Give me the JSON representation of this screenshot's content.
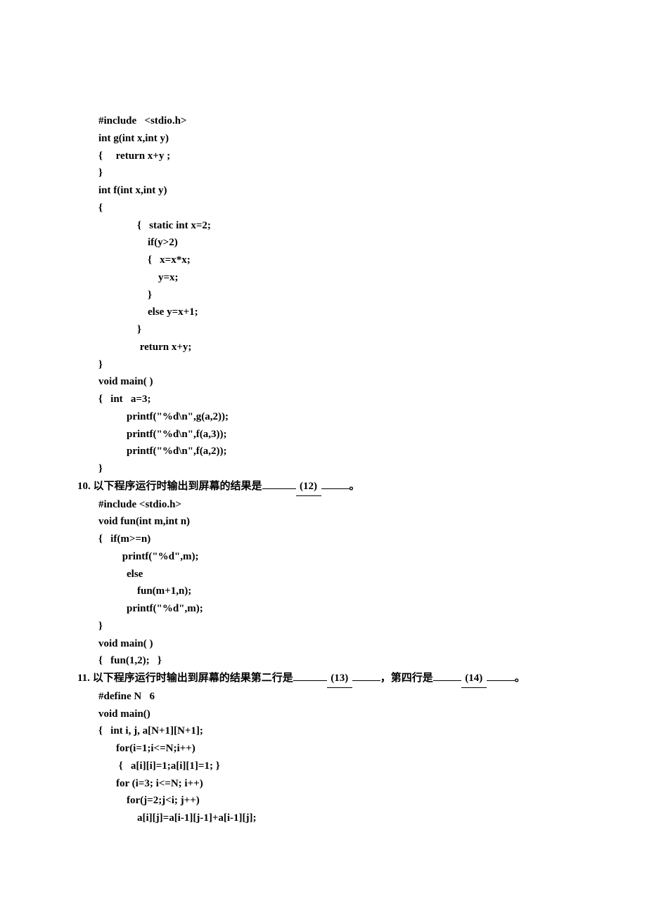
{
  "code9": {
    "l1": "#include   <stdio.h>",
    "l2": "int g(int x,int y)",
    "l3": "{     return x+y ;",
    "l4": "}",
    "l5": "int f(int x,int y)",
    "l6": "{",
    "l7": "    {   static int x=2;",
    "l8": "        if(y>2)",
    "l9": "        {   x=x*x;",
    "l10": "            y=x;",
    "l11": "        }",
    "l12": "        else y=x+1;",
    "l13": "    }",
    "l14": "     return x+y;",
    "l15": "}",
    "l16": "void main( )",
    "l17": "{   int   a=3;",
    "l18": "    printf(\"%d\\n\",g(a,2));",
    "l19": "    printf(\"%d\\n\",f(a,3));",
    "l20": "    printf(\"%d\\n\",f(a,2));",
    "l21": "}"
  },
  "q10": {
    "num": "10.",
    "text_a": "以下程序运行时输出到屏幕的结果是",
    "blank_label": "(12)",
    "tail": "。"
  },
  "code10": {
    "l1": "#include <stdio.h>",
    "l2": "void fun(int m,int n)",
    "l3": "{   if(m>=n)",
    "l4": "         printf(\"%d\",m);",
    "l5": "    else",
    "l6": "        fun(m+1,n);",
    "l7": "    printf(\"%d\",m);",
    "l8": "}",
    "l9": "void main( )",
    "l10": "{   fun(1,2);   }"
  },
  "q11": {
    "num": "11.",
    "text_a": "以下程序运行时输出到屏幕的结果第二行是",
    "blank_label_1": "(13)",
    "mid": "，第四行是",
    "blank_label_2": "(14)",
    "tail": "。"
  },
  "code11": {
    "l1": "#define N   6",
    "l2": "void main()",
    "l3": "{   int i, j, a[N+1][N+1];",
    "l4": "    for(i=1;i<=N;i++)",
    "l5": "     {   a[i][i]=1;a[i][1]=1; }",
    "l6": "    for (i=3; i<=N; i++)",
    "l7": "        for(j=2;j<i; j++)",
    "l8": "            a[i][j]=a[i-1][j-1]+a[i-1][j];"
  }
}
